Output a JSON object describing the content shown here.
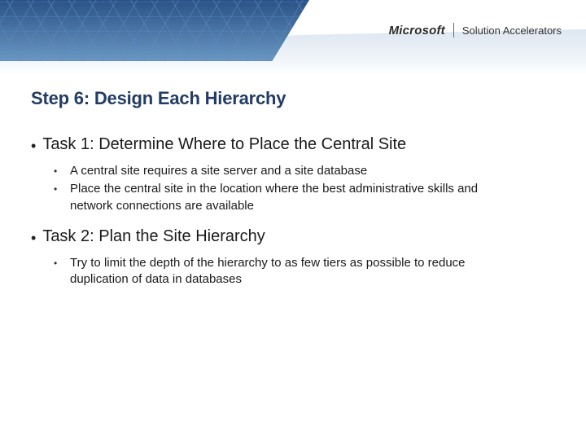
{
  "brand": {
    "left": "Microsoft",
    "right": "Solution Accelerators"
  },
  "title": "Step 6: Design Each Hierarchy",
  "tasks": [
    {
      "heading": "Task 1: Determine Where to Place the Central Site",
      "items": [
        "A central site requires a site server and a site database",
        "Place the central site in the location where the best administrative skills and network connections are available"
      ]
    },
    {
      "heading": "Task 2: Plan the Site Hierarchy",
      "items": [
        "Try to limit the depth of the hierarchy to as few tiers as possible to reduce duplication of data in databases"
      ]
    }
  ]
}
